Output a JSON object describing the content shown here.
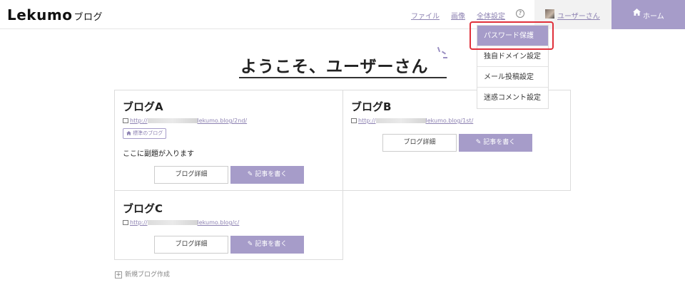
{
  "header": {
    "logo": "Lekumo",
    "logo_sub": "ブログ",
    "nav": {
      "files": "ファイル",
      "images": "画像",
      "settings": "全体設定",
      "help": "?"
    },
    "user_name": "ユーザーさん",
    "home": "ホーム"
  },
  "dropdown": {
    "items": [
      "パスワード保護",
      "独自ドメイン設定",
      "メール投稿設定",
      "迷惑コメント設定"
    ],
    "active_index": 0
  },
  "welcome": "ようこそ、ユーザーさん",
  "blogs": [
    {
      "title": "ブログA",
      "url_prefix": "http://",
      "url_suffix": "lekumo.blog/2nd/",
      "badge": "標準のブログ",
      "subtitle": "ここに副題が入ります",
      "detail_label": "ブログ詳細",
      "write_label": "記事を書く"
    },
    {
      "title": "ブログB",
      "url_prefix": "http://",
      "url_suffix": "lekumo.blog/1st/",
      "detail_label": "ブログ詳細",
      "write_label": "記事を書く"
    },
    {
      "title": "ブログC",
      "url_prefix": "http://",
      "url_suffix": "lekumo.blog/c/",
      "detail_label": "ブログ詳細",
      "write_label": "記事を書く"
    }
  ],
  "new_blog": "新規ブログ作成",
  "colors": {
    "accent": "#a69cc9",
    "link": "#8d82b2",
    "highlight": "#e0303a"
  }
}
